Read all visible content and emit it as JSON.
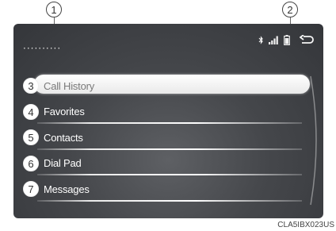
{
  "callouts": {
    "c1": "1",
    "c2": "2"
  },
  "screen": {
    "title_placeholder": "··········",
    "status_icons": [
      "bluetooth-icon",
      "signal-strength-icon",
      "battery-icon"
    ],
    "back_icon": "back-arrow-icon"
  },
  "menu": {
    "items": [
      {
        "num": "3",
        "label": "Call History",
        "selected": true
      },
      {
        "num": "4",
        "label": "Favorites"
      },
      {
        "num": "5",
        "label": "Contacts"
      },
      {
        "num": "6",
        "label": "Dial Pad"
      },
      {
        "num": "7",
        "label": "Messages"
      }
    ]
  },
  "figure_code": "CLA5IBX023US"
}
